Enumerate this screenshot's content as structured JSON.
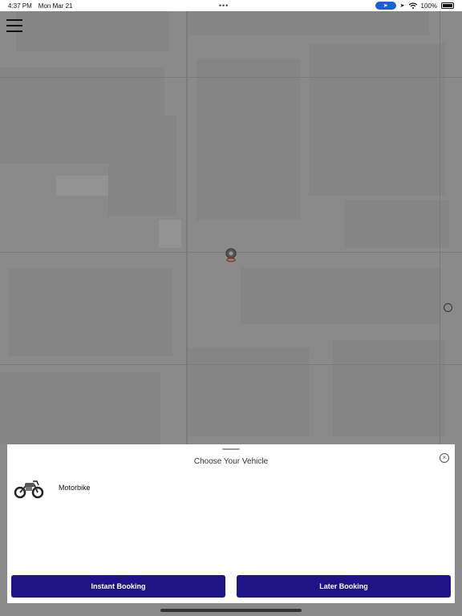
{
  "status_bar": {
    "time": "4:37 PM",
    "date": "Mon Mar 21",
    "dots": "•••",
    "battery": "100%",
    "location_icon": "location-arrow-icon",
    "wifi_icon": "wifi-icon"
  },
  "map": {
    "menu_icon": "hamburger-menu-icon",
    "pin_icon": "location-pin-icon"
  },
  "sheet": {
    "title": "Choose Your Vehicle",
    "close_glyph": "×",
    "vehicles": [
      {
        "label": "Motorbike",
        "icon": "motorbike-icon"
      }
    ],
    "instant_label": "Instant Booking",
    "later_label": "Later Booking"
  },
  "colors": {
    "button_bg": "#1e1486",
    "map_overlay": "#7f7f7f"
  }
}
